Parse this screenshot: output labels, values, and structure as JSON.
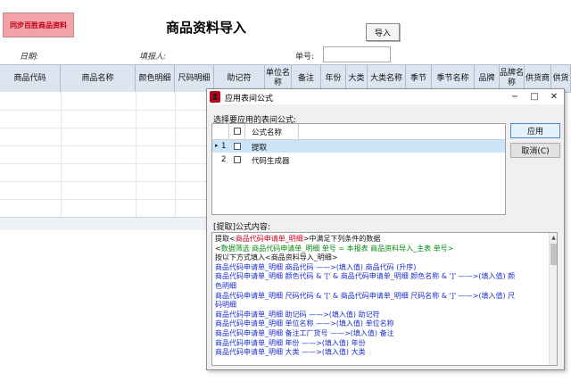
{
  "sheet": {
    "sync_button": "同步百胜商品资料",
    "title": "商品资料导入",
    "import_button": "导入",
    "date_label": "日期:",
    "reporter_label": "填报人:",
    "doc_no_label": "单号:",
    "doc_no_value": "",
    "columns": [
      "商品代码",
      "商品名称",
      "颜色明细",
      "尺码明细",
      "助记符",
      "单位名称",
      "备注",
      "年份",
      "大类",
      "大类名称",
      "季节",
      "季节名称",
      "品牌",
      "品牌名称",
      "供货商",
      "供货"
    ]
  },
  "dialog": {
    "title": "应用表间公式",
    "select_label": "选择要应用的表间公式:",
    "list_header": "公式名称",
    "rows": [
      {
        "indicator": "▸",
        "num": "1",
        "name": "提取",
        "selected": true
      },
      {
        "indicator": "",
        "num": "2",
        "name": "代码生成器",
        "selected": false
      }
    ],
    "apply_button": "应用",
    "cancel_button": "取消(C)",
    "content_label": "[提取]公式内容:",
    "minimize_glyph": "−",
    "maximize_glyph": "□",
    "close_glyph": "✕",
    "content_lines": [
      {
        "parts": [
          {
            "t": "提取<",
            "c": ""
          },
          {
            "t": "商品代码申请单_明细",
            "c": "red"
          },
          {
            "t": ">中满足下列条件的数据",
            "c": ""
          }
        ]
      },
      {
        "parts": [
          {
            "t": "  <",
            "c": ""
          },
          {
            "t": "数据筛选",
            "c": "green"
          },
          {
            "t": " 商品代码申请单_明细 单号 = 本报表 商品资料导入_主表 单号>",
            "c": "green"
          }
        ]
      },
      {
        "parts": [
          {
            "t": "按以下方式填入<商品资料导入_明细>",
            "c": ""
          }
        ]
      },
      {
        "parts": [
          {
            "t": "商品代码申请单_明细 商品代码  ——>(填入值)  商品代码  (升序)",
            "c": "blue"
          }
        ]
      },
      {
        "parts": [
          {
            "t": "商品代码申请单_明细 颜色代码 & '[' & 商品代码申请单_明细 颜色名称 & ']'  ——>(填入值)  颜",
            "c": "blue"
          }
        ]
      },
      {
        "parts": [
          {
            "t": "色明细",
            "c": "blue"
          }
        ]
      },
      {
        "parts": [
          {
            "t": "商品代码申请单_明细 尺码代码 & '[' & 商品代码申请单_明细 尺码名称 & ']'  ——>(填入值)  尺",
            "c": "blue"
          }
        ]
      },
      {
        "parts": [
          {
            "t": "码明细",
            "c": "blue"
          }
        ]
      },
      {
        "parts": [
          {
            "t": "商品代码申请单_明细 助记码  ——>(填入值)  助记符",
            "c": "blue"
          }
        ]
      },
      {
        "parts": [
          {
            "t": "商品代码申请单_明细 单位名称  ——>(填入值)  单位名称",
            "c": "blue"
          }
        ]
      },
      {
        "parts": [
          {
            "t": "商品代码申请单_明细 备注工厂货号  ——>(填入值)  备注",
            "c": "blue"
          }
        ]
      },
      {
        "parts": [
          {
            "t": "商品代码申请单_明细 年份  ——>(填入值)  年份",
            "c": "blue"
          }
        ]
      },
      {
        "parts": [
          {
            "t": "商品代码申请单_明细 大类  ——>(填入值)  大类",
            "c": "blue"
          }
        ]
      }
    ]
  },
  "colors": {
    "header_bg": "#dde5f1",
    "selected_row": "#cce4f7",
    "sync_button_bg": "#f2a3a8",
    "sync_button_text": "#c40018"
  }
}
